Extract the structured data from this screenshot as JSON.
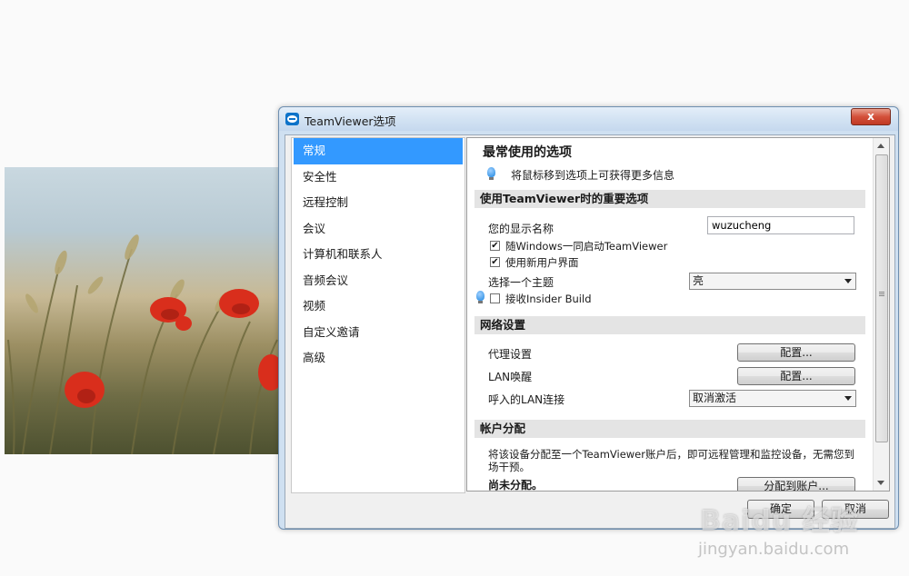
{
  "window": {
    "title": "TeamViewer选项",
    "close_label": "x"
  },
  "nav": {
    "items": [
      {
        "label": "常规",
        "selected": true
      },
      {
        "label": "安全性"
      },
      {
        "label": "远程控制"
      },
      {
        "label": "会议"
      },
      {
        "label": "计算机和联系人"
      },
      {
        "label": "音频会议"
      },
      {
        "label": "视频"
      },
      {
        "label": "自定义邀请"
      },
      {
        "label": "高级"
      }
    ]
  },
  "content": {
    "heading": "最常使用的选项",
    "hint": "将鼠标移到选项上可获得更多信息",
    "important": {
      "section_title": "使用TeamViewer时的重要选项",
      "display_name_label": "您的显示名称",
      "display_name_value": "wuzucheng",
      "start_with_windows_label": "随Windows一同启动TeamViewer",
      "start_with_windows_checked": "✔",
      "new_ui_label": "使用新用户界面",
      "new_ui_checked": "✔",
      "theme_label": "选择一个主题",
      "theme_value": "亮",
      "insider_label": "接收Insider Build",
      "insider_checked": ""
    },
    "network": {
      "section_title": "网络设置",
      "proxy_label": "代理设置",
      "proxy_button": "配置...",
      "lan_wake_label": "LAN唤醒",
      "lan_wake_button": "配置...",
      "incoming_lan_label": "呼入的LAN连接",
      "incoming_lan_value": "取消激活"
    },
    "account": {
      "section_title": "帐户分配",
      "description": "将该设备分配至一个TeamViewer账户后，即可远程管理和监控设备，无需您到场干预。",
      "status": "尚未分配。",
      "assign_button": "分配到账户..."
    }
  },
  "footer": {
    "ok_label": "确定",
    "cancel_label": "取消"
  },
  "watermark": {
    "brand": "Baidu 经验",
    "url": "jingyan.baidu.com"
  }
}
